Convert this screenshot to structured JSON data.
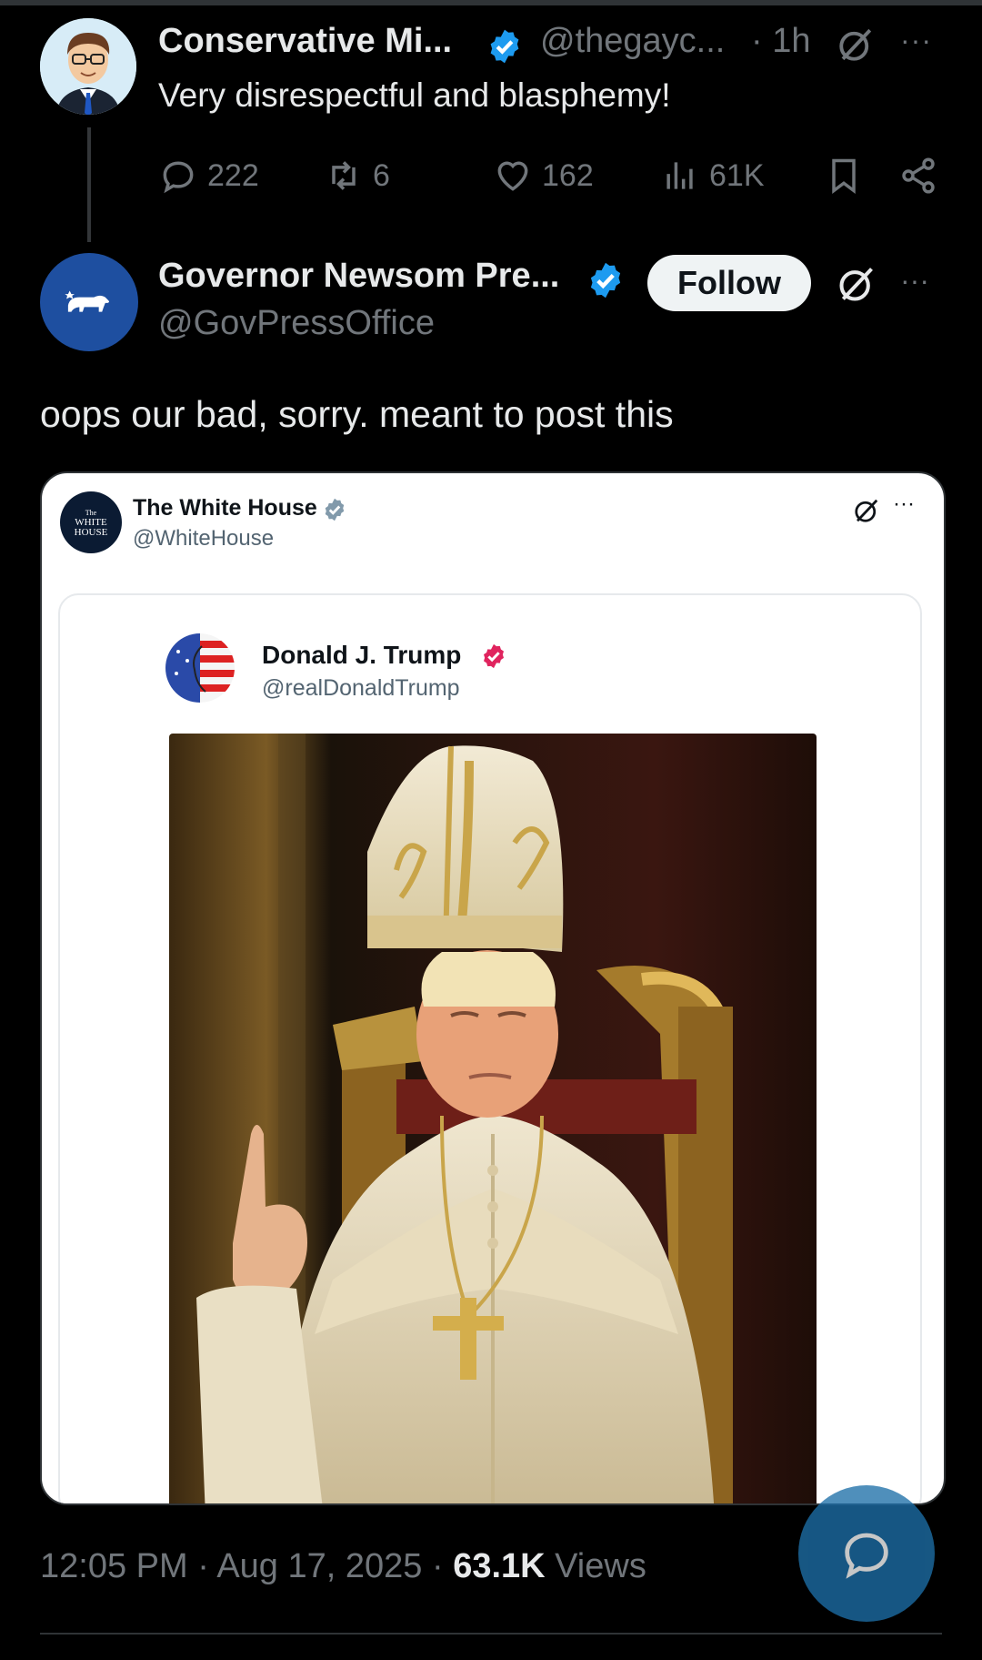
{
  "reply_tweet": {
    "display_name": "Conservative Mi...",
    "handle": "@thegayc...",
    "time": "· 1h",
    "more": "···",
    "text": "Very disrespectful and blasphemy!",
    "icons": [
      "verified-icon",
      "grok-icon",
      "more-icon"
    ],
    "actions": {
      "replies": "222",
      "reposts": "6",
      "likes": "162",
      "views": "61K"
    }
  },
  "main_tweet": {
    "display_name": "Governor Newsom Pre...",
    "handle": "@GovPressOffice",
    "follow_label": "Follow",
    "more": "···",
    "text": "oops our bad, sorry. meant to post this",
    "timestamp": "12:05 PM · Aug 17, 2025 · ",
    "views_count": "63.1K",
    "views_label": " Views"
  },
  "embedded": {
    "account_name": "The White House",
    "account_handle": "@WhiteHouse",
    "avatar_lines": [
      "The",
      "WHITE",
      "HOUSE"
    ],
    "more": "···",
    "quoted": {
      "account_name": "Donald J. Trump",
      "account_handle": "@realDonaldTrump"
    }
  },
  "colors": {
    "background": "#000000",
    "text_primary": "#e7e9ea",
    "text_secondary": "#71767b",
    "verified_blue": "#1d9bf0",
    "verified_gray": "#829aab",
    "verified_red": "#e0245e",
    "fab": "#1d6fa8"
  }
}
